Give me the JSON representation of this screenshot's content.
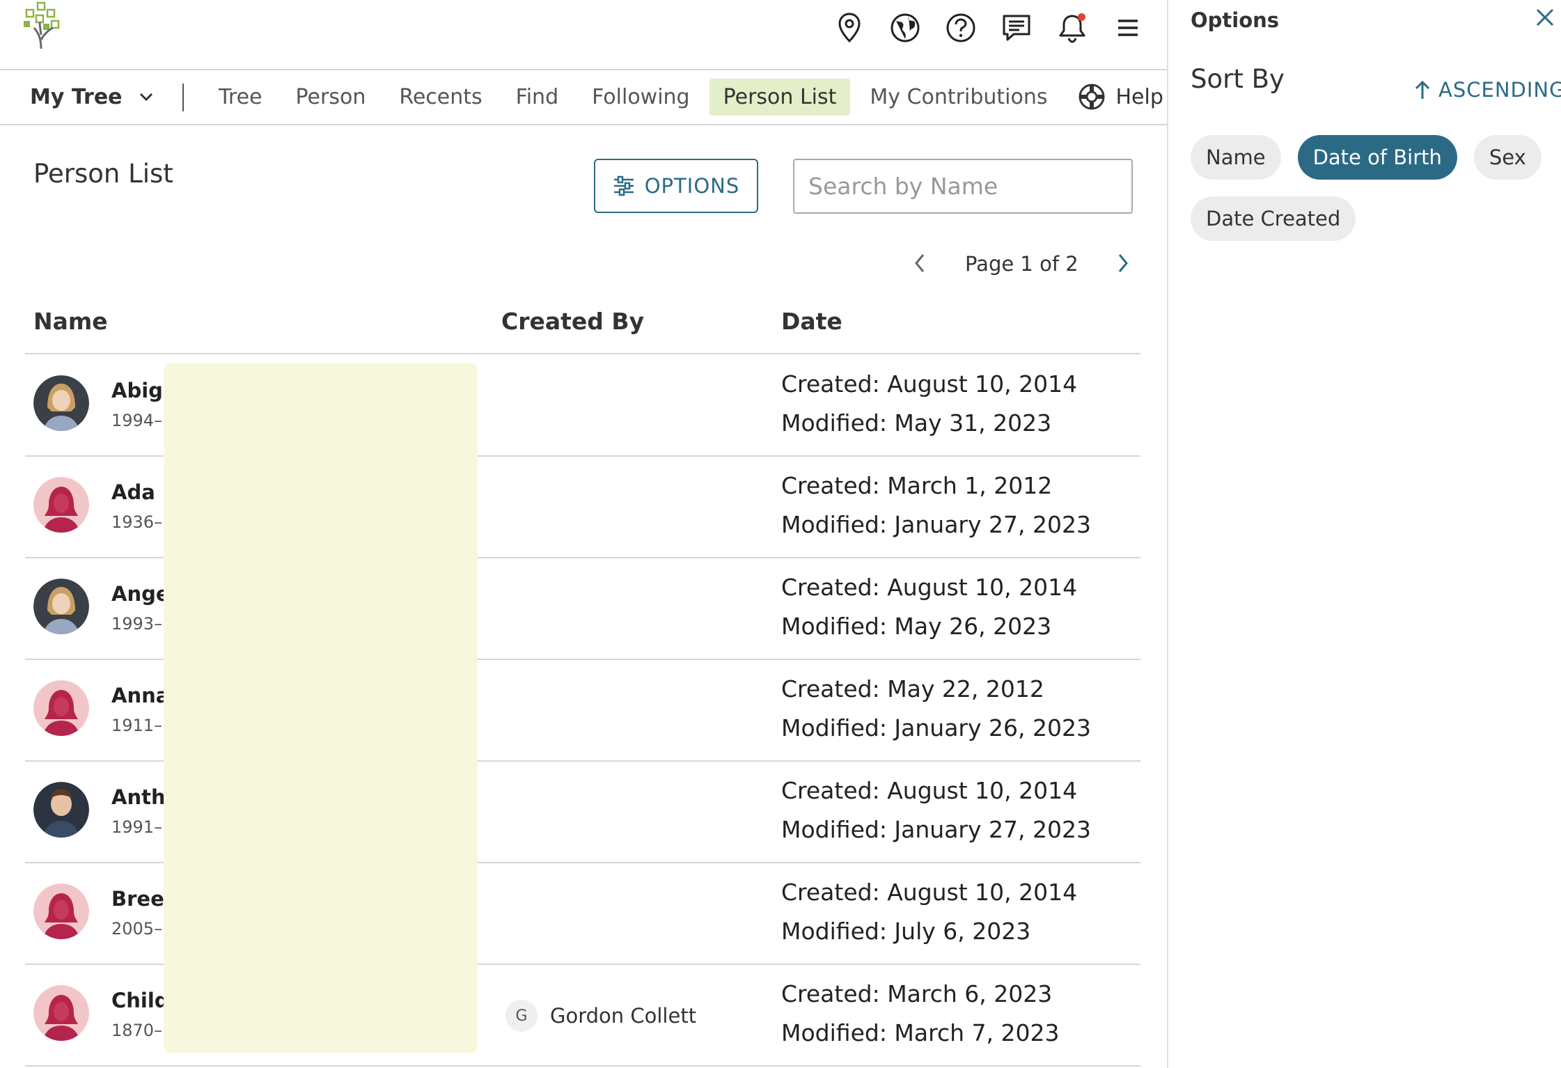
{
  "header": {
    "icons": [
      "map-pin-icon",
      "globe-icon",
      "help-icon",
      "chat-icon",
      "bell-icon",
      "menu-icon"
    ]
  },
  "nav": {
    "tree_menu_label": "My Tree",
    "items": [
      {
        "label": "Tree",
        "active": false
      },
      {
        "label": "Person",
        "active": false
      },
      {
        "label": "Recents",
        "active": false
      },
      {
        "label": "Find",
        "active": false
      },
      {
        "label": "Following",
        "active": false
      },
      {
        "label": "Person List",
        "active": true
      },
      {
        "label": "My Contributions",
        "active": false
      }
    ],
    "help_label": "Help Others"
  },
  "main": {
    "page_title": "Person List",
    "options_label": "OPTIONS",
    "search_placeholder": "Search by Name",
    "pagination": "Page 1 of 2",
    "columns": {
      "name": "Name",
      "created_by": "Created By",
      "date": "Date"
    },
    "rows": [
      {
        "name": "Abiga",
        "life": "1994–",
        "created_by": "",
        "created_by_initial": "",
        "created": "Created: August 10, 2014",
        "modified": "Modified: May 31, 2023",
        "avatar": "photo-girl"
      },
      {
        "name": "Ada I",
        "life": "1936–",
        "created_by": "",
        "created_by_initial": "",
        "created": "Created: March 1, 2012",
        "modified": "Modified: January 27, 2023",
        "avatar": "female-placeholder"
      },
      {
        "name": "Ange",
        "life": "1993–",
        "created_by": "",
        "created_by_initial": "",
        "created": "Created: August 10, 2014",
        "modified": "Modified: May 26, 2023",
        "avatar": "photo-girl"
      },
      {
        "name": "Anna",
        "life": "1911–",
        "created_by": "",
        "created_by_initial": "",
        "created": "Created: May 22, 2012",
        "modified": "Modified: January 26, 2023",
        "avatar": "female-placeholder"
      },
      {
        "name": "Anth",
        "life": "1991–",
        "created_by": "",
        "created_by_initial": "",
        "created": "Created: August 10, 2014",
        "modified": "Modified: January 27, 2023",
        "avatar": "photo-boy"
      },
      {
        "name": "Bree",
        "life": "2005–",
        "created_by": "",
        "created_by_initial": "",
        "created": "Created: August 10, 2014",
        "modified": "Modified: July 6, 2023",
        "avatar": "female-placeholder"
      },
      {
        "name": "Child",
        "life": "1870–",
        "created_by": "Gordon Collett",
        "created_by_initial": "G",
        "created": "Created: March 6, 2023",
        "modified": "Modified: March 7, 2023",
        "avatar": "female-placeholder"
      }
    ]
  },
  "options_panel": {
    "title": "Options",
    "sort_by_label": "Sort By",
    "direction_label": "ASCENDING",
    "sort_options": [
      {
        "label": "Name",
        "selected": false
      },
      {
        "label": "Date of Birth",
        "selected": true
      },
      {
        "label": "Sex",
        "selected": false
      },
      {
        "label": "Date Created",
        "selected": false
      }
    ]
  },
  "colors": {
    "accent": "#2b6a85",
    "active_tab": "#e2efc8",
    "notification": "#e0452d",
    "redaction": "#f7f7dd"
  }
}
